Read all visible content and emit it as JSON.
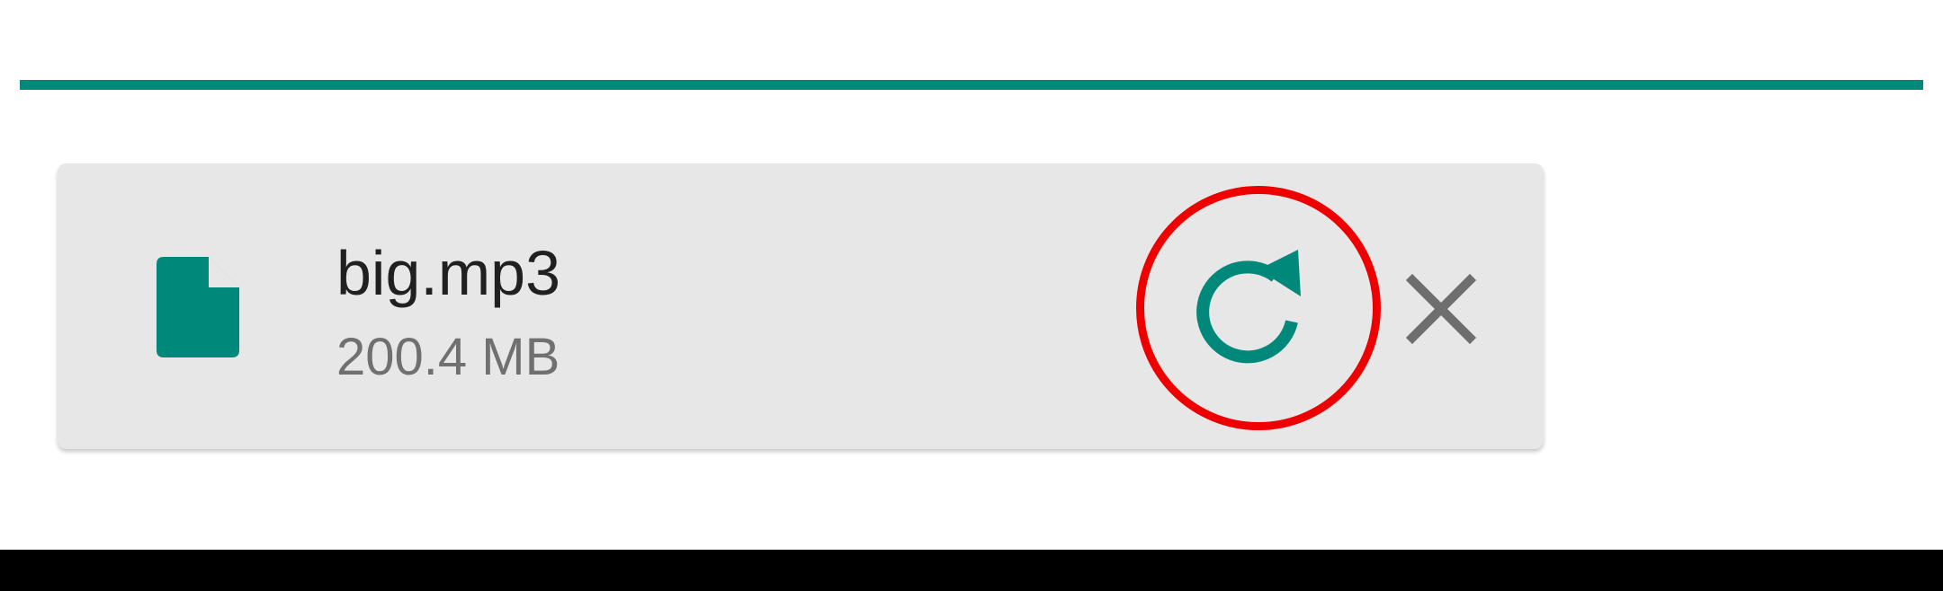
{
  "download": {
    "progress_percent": 100,
    "file_name": "big.mp3",
    "file_size": "200.4 MB",
    "file_icon": "file-icon",
    "retry_icon": "retry-icon",
    "close_icon": "close-icon"
  },
  "colors": {
    "accent": "#00897b",
    "highlight": "#ee0000",
    "card_background": "#e7e7e7",
    "close_icon": "#6e6e6e",
    "file_name_text": "#202020",
    "file_size_text": "#707070"
  }
}
